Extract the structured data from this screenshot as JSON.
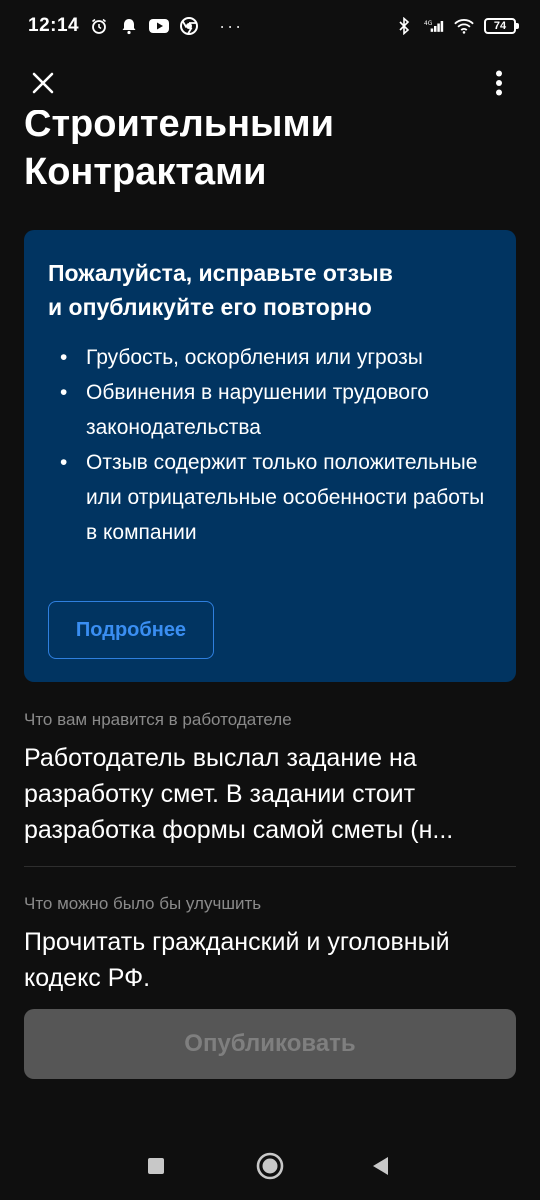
{
  "status_bar": {
    "time": "12:14",
    "dots": "···",
    "battery": "74",
    "icons": [
      "alarm-icon",
      "notification-icon",
      "youtube-icon",
      "chrome-icon",
      "bluetooth-icon",
      "signal-icon",
      "wifi-icon",
      "battery-icon"
    ]
  },
  "toolbar": {
    "close_icon": "close-icon",
    "more_icon": "more-vertical-icon"
  },
  "heading": {
    "line1": "Строительными",
    "line2": "Контрактами"
  },
  "notice": {
    "title_line1": "Пожалуйста, исправьте отзыв",
    "title_line2": "и опубликуйте его повторно",
    "items": [
      "Грубость, оскорбления или угрозы",
      "Обвинения в нарушении трудового законодательства",
      "Отзыв содержит только положительные или отрицательные особенности работы в компании"
    ],
    "more_label": "Подробнее",
    "background_color": "#013461",
    "accent_color": "#3a8ef2"
  },
  "likes": {
    "label": "Что вам нравится в работодателе",
    "value": "Работодатель выслал задание на разработку смет. В задании стоит разработка формы самой сметы (н..."
  },
  "improve": {
    "label": "Что можно было бы улучшить",
    "value": "Прочитать гражданский и уголовный кодекс РФ."
  },
  "publish": {
    "label": "Опубликовать"
  },
  "nav": {
    "icons": [
      "recent-apps-icon",
      "home-icon",
      "back-icon"
    ]
  }
}
